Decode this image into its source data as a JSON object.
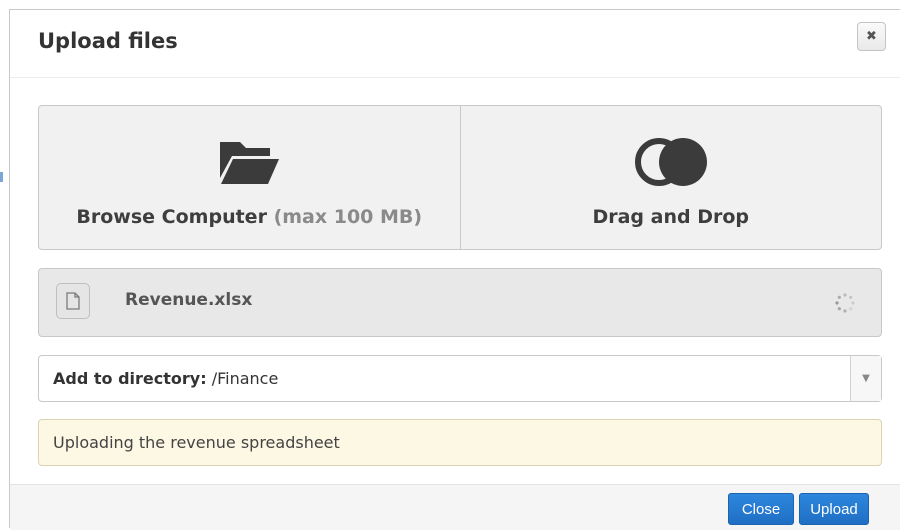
{
  "dialog": {
    "title": "Upload files",
    "close_icon": "close-x-icon"
  },
  "options": {
    "browse": {
      "icon": "folder-open-icon",
      "label": "Browse Computer",
      "limit": "(max 100 MB)"
    },
    "drag_drop": {
      "icon": "drag-drop-circles-icon",
      "label": "Drag and Drop"
    }
  },
  "file": {
    "icon": "file-icon",
    "name": "Revenue.xlsx",
    "status_icon": "loading-spinner-icon"
  },
  "directory": {
    "label": "Add to directory:",
    "value": "/Finance",
    "arrow_icon": "caret-down-icon"
  },
  "note": {
    "text": "Uploading the revenue spreadsheet"
  },
  "footer": {
    "close_label": "Close",
    "upload_label": "Upload"
  },
  "colors": {
    "primary_button": "#1f6fc4",
    "note_background": "#fcf8e3"
  }
}
